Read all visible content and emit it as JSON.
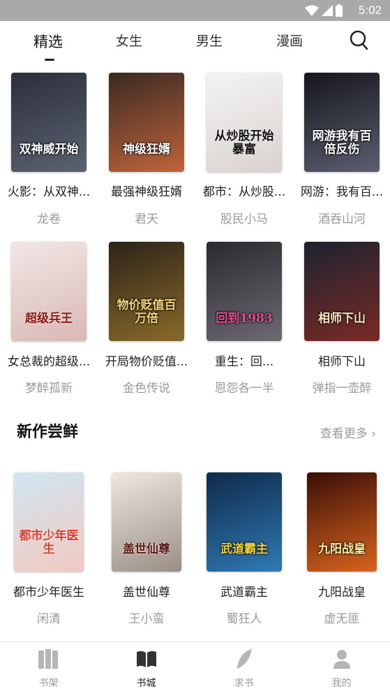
{
  "status_bar": {
    "time": "5:02"
  },
  "tabs": [
    {
      "label": "精选",
      "active": true
    },
    {
      "label": "女生",
      "active": false
    },
    {
      "label": "男生",
      "active": false
    },
    {
      "label": "漫画",
      "active": false
    }
  ],
  "featured_rows": [
    [
      {
        "title": "火影：从双神...",
        "author": "龙卷",
        "cover_text": "双神威开始",
        "cover_colors": [
          "#2b2f3a",
          "#5b6270"
        ]
      },
      {
        "title": "最强神级狂婿",
        "author": "君天",
        "cover_text": "神级狂婿",
        "cover_colors": [
          "#3a2a22",
          "#c0643b"
        ]
      },
      {
        "title": "都市：从炒股...",
        "author": "股民小马",
        "cover_text": "从炒股开始暴富",
        "cover_colors": [
          "#f4f4f4",
          "#d9d2cf"
        ]
      },
      {
        "title": "网游：我有百...",
        "author": "酒吞山河",
        "cover_text": "网游我有百倍反伤",
        "cover_colors": [
          "#15161c",
          "#5b5e70"
        ]
      }
    ],
    [
      {
        "title": "女总裁的超级...",
        "author": "梦醉孤新",
        "cover_text": "超级兵王",
        "cover_colors": [
          "#f1e7e6",
          "#d9b8b4"
        ]
      },
      {
        "title": "开局物价贬值...",
        "author": "金色传说",
        "cover_text": "物价贬值百万倍",
        "cover_colors": [
          "#2c2418",
          "#8a6a2a"
        ]
      },
      {
        "title": "重生：回...",
        "author": "恩怨各一半",
        "cover_text": "回到1983",
        "cover_colors": [
          "#2a2a2e",
          "#6d6a72"
        ]
      },
      {
        "title": "相师下山",
        "author": "弹指一壶醉",
        "cover_text": "相师下山",
        "cover_colors": [
          "#1d2230",
          "#7a2a25"
        ]
      }
    ]
  ],
  "new_section": {
    "title": "新作尝鲜",
    "more_label": "查看更多 ›"
  },
  "new_books": [
    {
      "title": "都市少年医生",
      "author": "闲清",
      "cover_text": "都市少年医生",
      "cover_colors": [
        "#cfe6f2",
        "#f2c9c0"
      ]
    },
    {
      "title": "盖世仙尊",
      "author": "王小蛮",
      "cover_text": "盖世仙尊",
      "cover_colors": [
        "#efe8e0",
        "#9a8f86"
      ]
    },
    {
      "title": "武道霸主",
      "author": "蜀狂人",
      "cover_text": "武道霸主",
      "cover_colors": [
        "#0f2a4a",
        "#2f7ab5"
      ]
    },
    {
      "title": "九阳战皇",
      "author": "虚无匪",
      "cover_text": "九阳战皇",
      "cover_colors": [
        "#3a0e08",
        "#d9641c"
      ]
    }
  ],
  "bottom_nav": [
    {
      "label": "书架",
      "icon": "bookshelf-icon",
      "active": false
    },
    {
      "label": "书城",
      "icon": "book-open-icon",
      "active": true
    },
    {
      "label": "求书",
      "icon": "feather-icon",
      "active": false
    },
    {
      "label": "我的",
      "icon": "person-icon",
      "active": false
    }
  ]
}
